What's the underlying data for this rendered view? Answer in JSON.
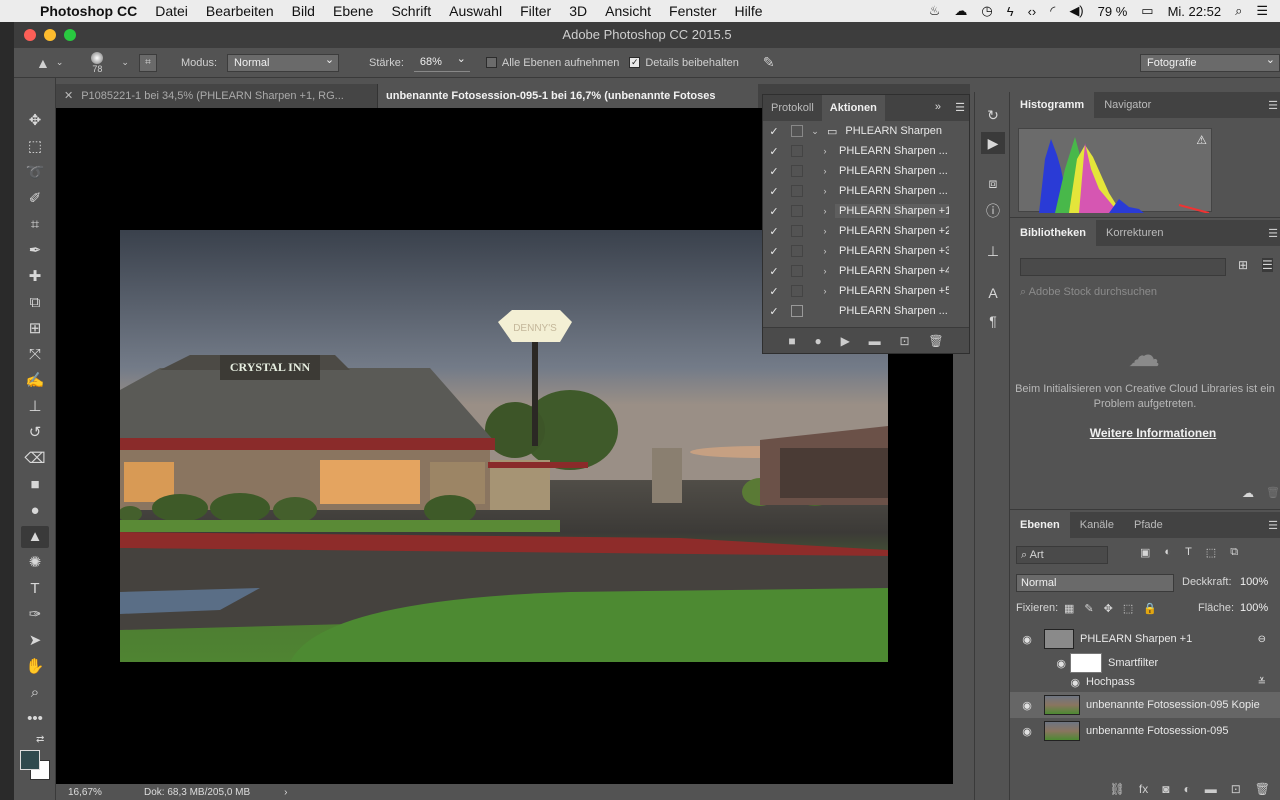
{
  "menubar": {
    "apple": "",
    "app": "Photoshop CC",
    "items": [
      "Datei",
      "Bearbeiten",
      "Bild",
      "Ebene",
      "Schrift",
      "Auswahl",
      "Filter",
      "3D",
      "Ansicht",
      "Fenster",
      "Hilfe"
    ],
    "battery": "79 %",
    "clock": "Mi. 22:52"
  },
  "window": {
    "title": "Adobe Photoshop CC 2015.5"
  },
  "options": {
    "brush_size": "78",
    "mode_label": "Modus:",
    "mode_value": "Normal",
    "strength_label": "Stärke:",
    "strength_value": "68%",
    "sample_all_label": "Alle Ebenen aufnehmen",
    "sample_all_checked": false,
    "protect_detail_label": "Details beibehalten",
    "protect_detail_checked": true,
    "workspace": "Fotografie"
  },
  "tabs": [
    {
      "label": "P1085221-1 bei 34,5% (PHLEARN Sharpen +1, RG...",
      "active": false
    },
    {
      "label": "unbenannte Fotosession-095-1 bei 16,7% (unbenannte Fotoses",
      "active": true
    }
  ],
  "statusbar": {
    "zoom": "16,67%",
    "doc": "Dok: 68,3 MB/205,0 MB"
  },
  "image_signs": {
    "hotel_sign": "CRYSTAL INN",
    "pole_sign": "DENNY'S"
  },
  "actions_panel": {
    "tabs": [
      "Protokoll",
      "Aktionen"
    ],
    "active_tab": "Aktionen",
    "set_name": "PHLEARN Sharpen",
    "items": [
      {
        "label": "PHLEARN Sharpen ...",
        "selected": false
      },
      {
        "label": "PHLEARN Sharpen ...",
        "selected": false
      },
      {
        "label": "PHLEARN Sharpen ...",
        "selected": false
      },
      {
        "label": "PHLEARN Sharpen +1",
        "selected": true
      },
      {
        "label": "PHLEARN Sharpen +2",
        "selected": false
      },
      {
        "label": "PHLEARN Sharpen +3",
        "selected": false
      },
      {
        "label": "PHLEARN Sharpen +4",
        "selected": false
      },
      {
        "label": "PHLEARN Sharpen +5",
        "selected": false
      },
      {
        "label": "PHLEARN Sharpen ...",
        "selected": false
      }
    ]
  },
  "histogram_panel": {
    "tabs": [
      "Histogramm",
      "Navigator"
    ],
    "active_tab": "Histogramm"
  },
  "library_panel": {
    "tabs": [
      "Bibliotheken",
      "Korrekturen"
    ],
    "active_tab": "Bibliotheken",
    "search_placeholder": "Adobe Stock durchsuchen",
    "message": "Beim Initialisieren von Creative Cloud Libraries ist ein Problem aufgetreten.",
    "link": "Weitere Informationen"
  },
  "layers_panel": {
    "tabs": [
      "Ebenen",
      "Kanäle",
      "Pfade"
    ],
    "active_tab": "Ebenen",
    "filter": "Art",
    "blend_mode": "Normal",
    "opacity_label": "Deckkraft:",
    "opacity_value": "100%",
    "lock_label": "Fixieren:",
    "fill_label": "Fläche:",
    "fill_value": "100%",
    "layers": [
      {
        "name": "PHLEARN Sharpen +1",
        "type": "smart"
      },
      {
        "name": "Smartfilter",
        "type": "filter-mask"
      },
      {
        "name": "Hochpass",
        "type": "filter"
      },
      {
        "name": "unbenannte Fotosession-095 Kopie",
        "type": "photo",
        "selected": true
      },
      {
        "name": "unbenannte Fotosession-095",
        "type": "photo"
      }
    ]
  },
  "colors": {
    "foreground": "#2f4a4e",
    "background": "#ffffff"
  }
}
